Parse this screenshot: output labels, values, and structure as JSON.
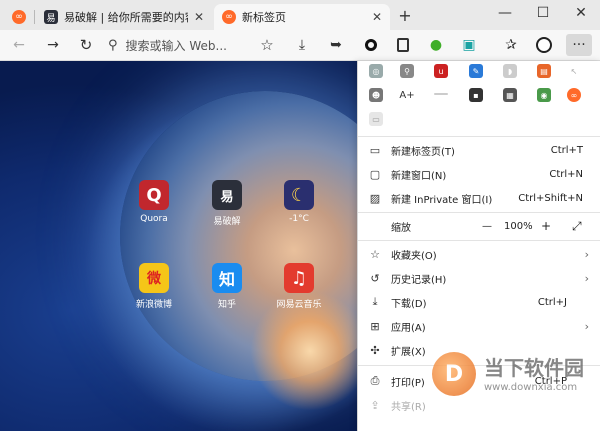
{
  "tabs": [
    {
      "label": "",
      "state": "inactive",
      "favicon": "edge-infinity-icon"
    },
    {
      "label": "易破解 | 给你所需要的内容YPOJI",
      "state": "inactive",
      "favicon": "yipojie-icon"
    },
    {
      "label": "新标签页",
      "state": "active",
      "favicon": "edge-infinity-icon"
    }
  ],
  "new_tab_symbol": "+",
  "window_controls": {
    "minimize": "—",
    "maximize": "☐",
    "close": "✕"
  },
  "address_bar": {
    "placeholder": "搜索或输入 Web..."
  },
  "tiles": [
    {
      "label": "Quora",
      "glyph": "Q",
      "color": "#c1272d"
    },
    {
      "label": "易破解",
      "glyph": "易",
      "color": "#2b2f3a"
    },
    {
      "label": "-1°C",
      "glyph": "☾",
      "color": "#2a2f6f"
    },
    {
      "label": "新浪微博",
      "glyph": "微",
      "color": "#f5c518"
    },
    {
      "label": "知乎",
      "glyph": "知",
      "color": "#1a8cf0"
    },
    {
      "label": "网易云音乐",
      "glyph": "♫",
      "color": "#e33b2e"
    }
  ],
  "menu": {
    "items": [
      {
        "label": "新建标签页(T)",
        "shortcut": "Ctrl+T",
        "icon": "new-tab-icon"
      },
      {
        "label": "新建窗口(N)",
        "shortcut": "Ctrl+N",
        "icon": "new-window-icon"
      },
      {
        "label": "新建 InPrivate 窗口(I)",
        "shortcut": "Ctrl+Shift+N",
        "icon": "inprivate-icon"
      }
    ],
    "zoom": {
      "label": "缩放",
      "minus": "—",
      "value": "100%",
      "plus": "+"
    },
    "items2": [
      {
        "label": "收藏夹(O)",
        "shortcut": "",
        "icon": "favorites-icon",
        "arrow": true
      },
      {
        "label": "历史记录(H)",
        "shortcut": "",
        "icon": "history-icon",
        "arrow": true
      },
      {
        "label": "下载(D)",
        "shortcut": "Ctrl+J",
        "icon": "download-icon",
        "arrow": false
      },
      {
        "label": "应用(A)",
        "shortcut": "",
        "icon": "apps-icon",
        "arrow": true
      },
      {
        "label": "扩展(X)",
        "shortcut": "",
        "icon": "extensions-icon",
        "arrow": false
      }
    ],
    "items3": [
      {
        "label": "打印(P)",
        "shortcut": "Ctrl+P",
        "icon": "print-icon"
      },
      {
        "label": "共享(R)",
        "shortcut": "",
        "icon": "share-icon"
      }
    ]
  },
  "watermark": {
    "glyph": "D",
    "text": "当下软件园",
    "url": "www.downxia.com"
  }
}
